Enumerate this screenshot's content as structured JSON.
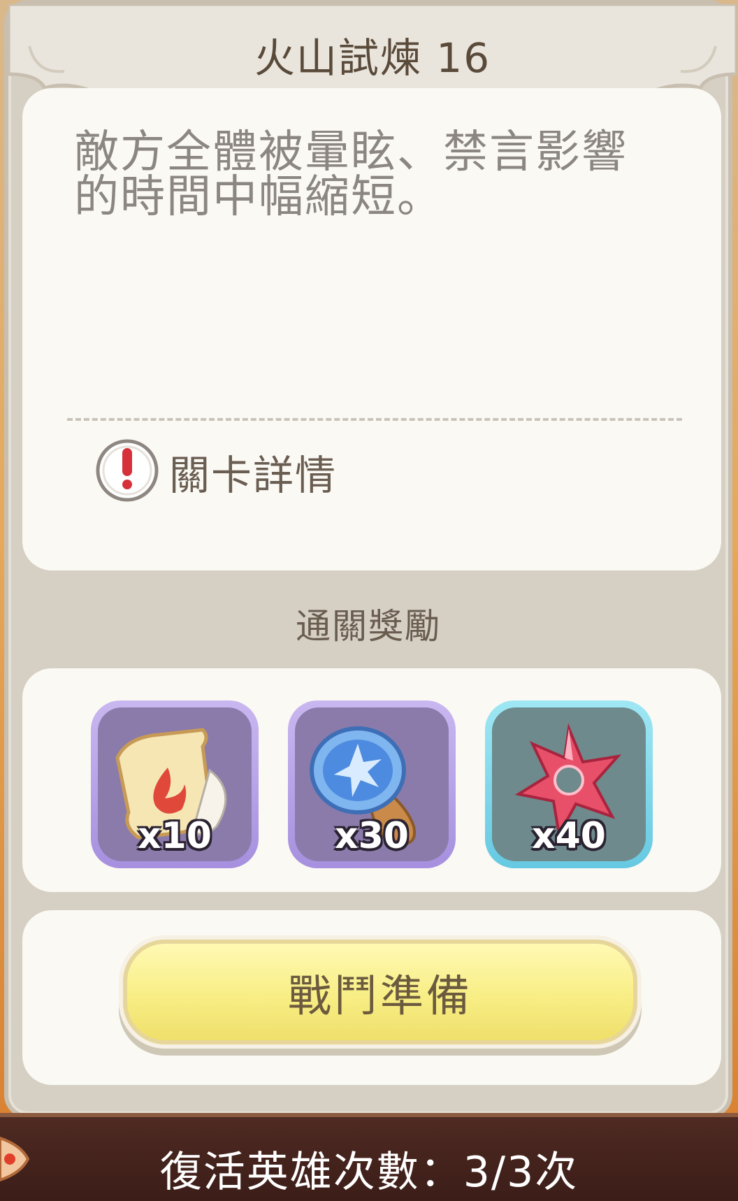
{
  "dialog": {
    "title": "火山試煉 16",
    "description": "敵方全體被暈眩、禁言影響的時間中幅縮短。",
    "detail_link": "關卡詳情",
    "rewards_title": "通關獎勵",
    "rewards": [
      {
        "icon": "fire-scroll-icon",
        "quantity": "x10",
        "frame_color": "#a690df"
      },
      {
        "icon": "star-stamp-icon",
        "quantity": "x30",
        "frame_color": "#a690df"
      },
      {
        "icon": "red-crystal-icon",
        "quantity": "x40",
        "frame_color": "#66c9e2"
      }
    ],
    "battle_button": "戰鬥準備"
  },
  "footer": {
    "revive_text": "復活英雄次數：3/3次"
  },
  "colors": {
    "button_yellow": "#f8ee85",
    "footer_bg": "#3c1d18",
    "panel_bg": "#fbf9f4"
  }
}
